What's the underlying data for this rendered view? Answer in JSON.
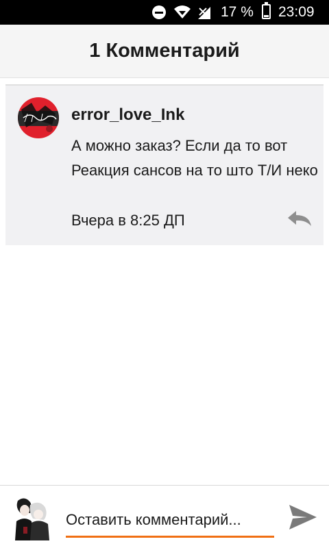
{
  "status_bar": {
    "battery": "17 %",
    "time": "23:09",
    "icons": [
      "do-not-disturb-icon",
      "wifi-icon",
      "signal-icon",
      "battery-icon"
    ]
  },
  "header": {
    "title": "1 Комментарий"
  },
  "comments": [
    {
      "author": "error_love_Ink",
      "text": "А можно заказ? Если да то вот Реакция сансов на то што Т/И неко",
      "timestamp": "Вчера в 8:25 ДП",
      "avatar": "avatar-image",
      "reply_icon": "reply-icon"
    }
  ],
  "composer": {
    "placeholder": "Оставить комментарий...",
    "send_icon": "send-icon"
  },
  "colors": {
    "accent": "#f06f13",
    "card_bg": "#f1f1f3",
    "header_bg": "#f5f5f5",
    "status_bar_bg": "#000000"
  }
}
